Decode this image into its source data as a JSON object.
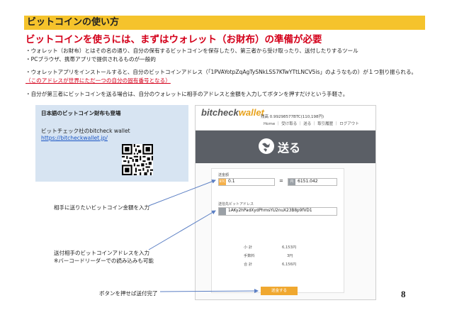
{
  "slide": {
    "title": "ビットコインの使い方",
    "headline": "ビットコインを使うには、まずはウォレット（お財布）の準備が必要",
    "bullets": [
      "・ウォレット（お財布）とはその名の通り、自分の保有するビットコインを保存したり、第三者から受け取ったり、送付したりするツール",
      "・PCブラウザ、携帯アプリで提供されるものが一般的",
      "・ウォレットアプリをインストールすると、自分のビットコインアドレス（「1PVAYotpZqAgTySNkLSS7KTwYTtLNCV5is」のようなもの）が１つ割り振られる。",
      "（このアドレスが世界にただ一つの自分の固有番号となる）",
      "・自分が第三者にビットコインを送る場合は、自分のウォレットに相手のアドレスと金額を入力してボタンを押すだけという手軽さ。"
    ],
    "page_number": "8"
  },
  "infobox": {
    "heading": "日本語のビットコイン財布も登場",
    "line1": "ビットチェック社のbitcheck wallet",
    "link": "https://bitcheckwallet.jp/"
  },
  "app": {
    "brand_prefix": "bitcheck",
    "brand_suffix": "wallet",
    "balance_line": "残高 0.99298577BTC(110,198円)",
    "nav": "Home ｜ 受け取る ｜ 送る ｜ 取引履歴 ｜ ログアウト",
    "send_title": "送る",
    "amount_label": "送金額",
    "btc_tag": "BTC",
    "amount_value": "0.1",
    "equals": "=",
    "jpy_tag": "円",
    "jpy_value": "6151.042",
    "address_label": "送信先ビットアドレス",
    "address_value": "1AKy2hPadXydPhmsYU2nuX23B8p9fVD1",
    "summary": [
      {
        "label": "小 計",
        "value": "6,153円"
      },
      {
        "label": "手数料",
        "value": "3円"
      },
      {
        "label": "合 計",
        "value": "6,156円"
      }
    ],
    "send_button": "送金する"
  },
  "callouts": {
    "amount": "相手に送りたいビットコイン金額を入力",
    "address_1": "送付相手のビットコインアドレスを入力",
    "address_2": "※バーコードリーダーでの読み込みも可能",
    "button": "ボタンを押せば送付完了"
  },
  "colors": {
    "title_bar": "#f5c32c",
    "headline_red": "#d4001a",
    "infobox_bg": "#d7e4f2",
    "send_band": "#5b5f66",
    "accent_orange": "#f0a830",
    "arrow_blue": "#5b7fc4"
  }
}
